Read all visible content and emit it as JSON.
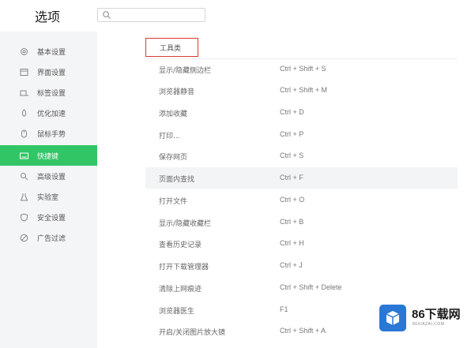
{
  "header": {
    "title": "选项",
    "search_placeholder": "",
    "search_value": ""
  },
  "sidebar": {
    "items": [
      {
        "label": "基本设置",
        "icon": "settings-icon",
        "active": false
      },
      {
        "label": "界面设置",
        "icon": "window-icon",
        "active": false
      },
      {
        "label": "标签设置",
        "icon": "tab-icon",
        "active": false
      },
      {
        "label": "优化加速",
        "icon": "rocket-icon",
        "active": false
      },
      {
        "label": "鼠标手势",
        "icon": "mouse-icon",
        "active": false
      },
      {
        "label": "快捷键",
        "icon": "keyboard-icon",
        "active": true
      },
      {
        "label": "高级设置",
        "icon": "search-icon",
        "active": false
      },
      {
        "label": "实验室",
        "icon": "flask-icon",
        "active": false
      },
      {
        "label": "安全设置",
        "icon": "shield-icon",
        "active": false
      },
      {
        "label": "广告过滤",
        "icon": "block-icon",
        "active": false
      }
    ]
  },
  "main": {
    "section_title": "工具类",
    "shortcuts": [
      {
        "action": "显示/隐藏侧边栏",
        "keys": "Ctrl + Shift + S"
      },
      {
        "action": "浏览器静音",
        "keys": "Ctrl + Shift + M"
      },
      {
        "action": "添加收藏",
        "keys": "Ctrl + D"
      },
      {
        "action": "打印...",
        "keys": "Ctrl + P"
      },
      {
        "action": "保存网页",
        "keys": "Ctrl + S"
      },
      {
        "action": "页面内查找",
        "keys": "Ctrl + F",
        "highlight": true
      },
      {
        "action": "打开文件",
        "keys": "Ctrl + O"
      },
      {
        "action": "显示/隐藏收藏栏",
        "keys": "Ctrl + B"
      },
      {
        "action": "查看历史记录",
        "keys": "Ctrl + H"
      },
      {
        "action": "打开下载管理器",
        "keys": "Ctrl + J"
      },
      {
        "action": "清除上网痕迹",
        "keys": "Ctrl + Shift + Delete"
      },
      {
        "action": "浏览器医生",
        "keys": "F1"
      },
      {
        "action": "开启/关闭图片放大镜",
        "keys": "Ctrl + Shift + A"
      }
    ]
  },
  "watermark": {
    "brand": "86下载网",
    "url": "86XIAZAI.COM"
  },
  "colors": {
    "accent": "#32c566",
    "highlight_border": "#d9392f",
    "logo_blue": "#2b77d6"
  }
}
